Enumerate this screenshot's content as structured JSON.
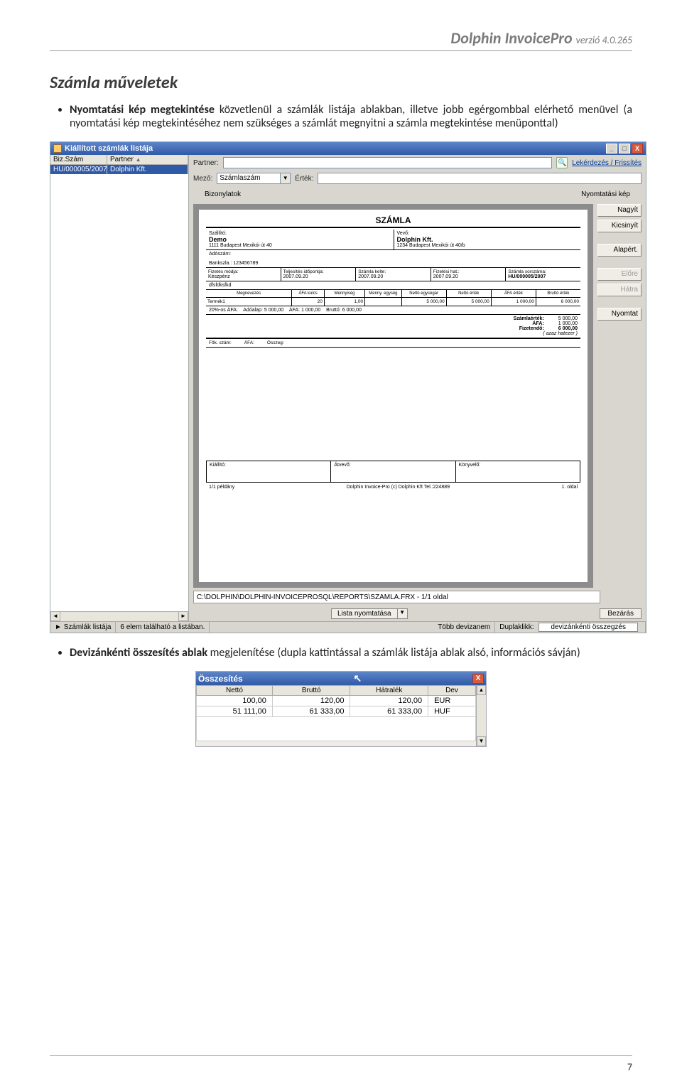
{
  "doc": {
    "header_app": "Dolphin InvoicePro",
    "header_ver": "verzió 4.0.265",
    "section_title": "Számla műveletek",
    "bullet1": "Nyomtatási kép megtekintése közvetlenül a számlák listája ablakban, illetve jobb egérgombbal elérhető menüvel (a nyomtatási kép megtekintéséhez nem szükséges a számlát megnyitni a számla megtekintése menüponttal)",
    "bullet2_bold": "Devizánkénti összesítés ablak",
    "bullet2_rest": " megjelenítése (dupla kattintással a számlák listája ablak alsó, információs sávján)",
    "page_number": "7"
  },
  "ss1": {
    "title": "Kiállított számlák listája",
    "win_min": "_",
    "win_max": "□",
    "win_close": "X",
    "grid_head_biz": "Biz.Szám",
    "grid_head_partner": "Partner",
    "row_biz": "HU/000005/2007",
    "row_partner": "Dolphin Kft.",
    "filter_partner_label": "Partner:",
    "link_refresh": "Lekérdezés / Frissítés",
    "filter_mezo_label": "Mező:",
    "filter_mezo_value": "Számlaszám",
    "filter_ertek_label": "Érték:",
    "tab_left": "Bizonylatok",
    "tab_right": "Nyomtatási kép",
    "side_btn1": "Nagyít",
    "side_btn2": "Kicsinyít",
    "side_btn3": "Alapért.",
    "side_btn4": "Előre",
    "side_btn5": "Hátra",
    "side_btn6": "Nyomtat",
    "pathbar": "C:\\DOLPHIN\\DOLPHIN-INVOICEPROSQL\\REPORTS\\SZAMLA.FRX - 1/1 oldal",
    "print_btn": "Lista nyomtatása",
    "close_btn": "Bezárás",
    "status_left": "Számlák listája",
    "status_mid": "6 elem található a listában.",
    "status_curr": "Több devizanem",
    "status_dbl_label": "Duplaklikk:",
    "status_dbl_val": "devizánkénti összegzés",
    "invoice": {
      "title": "SZÁMLA",
      "seller_lbl": "Szállító:",
      "seller_name": "Demo",
      "seller_addr": "1111 Budapest Mexikói út 40",
      "buyer_lbl": "Vevő:",
      "buyer_name": "Dolphin Kft.",
      "buyer_addr": "1234 Budapest Mexikói út 40/b",
      "adoszam_lbl": "Adószám:",
      "bank_lbl": "Bankszla.: 123456789",
      "m1_lbl": "Fizetés módja:",
      "m1_val": "Készpénz",
      "m2_lbl": "Teljesítés időpontja:",
      "m2_val": "2007.09.20",
      "m3_lbl": "Számla kelte:",
      "m3_val": "2007.09.20",
      "m4_lbl": "Fizetési hat.:",
      "m4_val": "2007.09.20",
      "m5_lbl": "Számla sorszáma:",
      "m5_val": "HU/000005/2007",
      "desc_row": "dfsfdksfkd",
      "ih_name": "Megnevezés",
      "ih_afa": "ÁFA kulcs",
      "ih_qty": "Mennyiség",
      "ih_unit": "Menny. egység",
      "ih_netto": "Nettó egységár",
      "ih_nettov": "Nettó érték",
      "ih_afav": "ÁFA érték",
      "ih_brutto": "Bruttó érték",
      "ir_name": "Termék1",
      "ir_afa": "20",
      "ir_qty": "1,00",
      "ir_unit": "",
      "ir_netto": "5 000,00",
      "ir_nettov": "5 000,00",
      "ir_afav": "1 000,00",
      "ir_brutto": "6 000,00",
      "sum_l1": "Adóalap:",
      "sum_l1v": "5 000,00",
      "sum_l2": "ÁFA:",
      "sum_l2v": "1 000,00",
      "sum_l3": "Bruttó:",
      "sum_l3v": "6 000,00",
      "sum_afa_label": "20%-os ÁFA:",
      "tot1_lbl": "Számlaérték:",
      "tot1_val": "5 000,00",
      "tot2_lbl": "ÁFA:",
      "tot2_val": "1 000,00",
      "tot3_lbl": "Fizetendő:",
      "tot3_val": "6 000,00",
      "tot_note": "( azaz hatezer )",
      "f1": "Fők. szám:",
      "f2": "ÁFA:",
      "f3": "Összeg:",
      "sign1": "Kiállító:",
      "sign2": "Átvevő:",
      "sign3": "Könyvelő:",
      "pg_left": "1/1 példány",
      "pg_mid": "Dolphin Invoice-Pro (c) Dolphin Kft Tel.:224889",
      "pg_right": "1. oldal"
    }
  },
  "ss2": {
    "title": "Összesítés",
    "h_netto": "Nettó",
    "h_brutto": "Bruttó",
    "h_hatralek": "Hátralék",
    "h_dev": "Dev",
    "rows": [
      {
        "netto": "100,00",
        "brutto": "120,00",
        "hatralek": "120,00",
        "dev": "EUR"
      },
      {
        "netto": "51 111,00",
        "brutto": "61 333,00",
        "hatralek": "61 333,00",
        "dev": "HUF"
      }
    ]
  }
}
